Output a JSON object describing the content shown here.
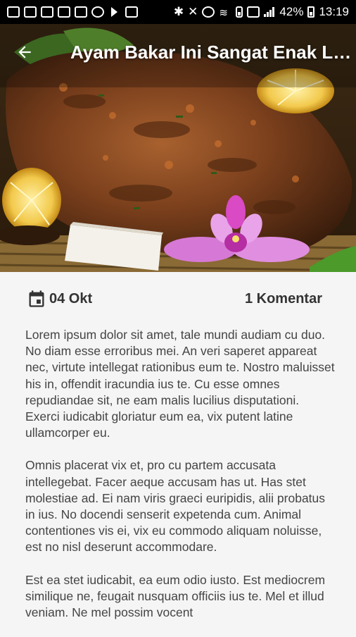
{
  "status_bar": {
    "battery": "42%",
    "time": "13:19"
  },
  "header": {
    "title": "Ayam Bakar Ini Sangat Enak Lho",
    "back_icon": "arrow-left-icon"
  },
  "meta": {
    "date_icon": "calendar-icon",
    "date": "04 Okt",
    "comments": "1 Komentar"
  },
  "article": {
    "paragraphs": [
      "Lorem ipsum dolor sit amet, tale mundi audiam cu duo. No diam esse erroribus mei. An veri saperet appareat nec, virtute intellegat rationibus eum te. Nostro maluisset his in, offendit iracundia ius te. Cu esse omnes repudiandae sit, ne eam malis lucilius disputationi. Exerci iudicabit gloriatur eum ea, vix putent latine ullamcorper eu.",
      "Omnis placerat vix et, pro cu partem accusata intellegebat. Facer aeque accusam has ut. Has stet molestiae ad. Ei nam viris graeci euripidis, alii probatus in ius. No docendi senserit expetenda cum. Animal contentiones vis ei, vix eu commodo aliquam noluisse, est no nisl deserunt accommodare.",
      "Est ea stet iudicabit, ea eum odio iusto. Est mediocrem similique ne, feugait nusquam officiis ius te. Mel et illud veniam. Ne mel possim vocent"
    ]
  },
  "colors": {
    "status_bar_bg": "#000000",
    "page_bg": "#f5f5f5",
    "text": "#444444"
  }
}
